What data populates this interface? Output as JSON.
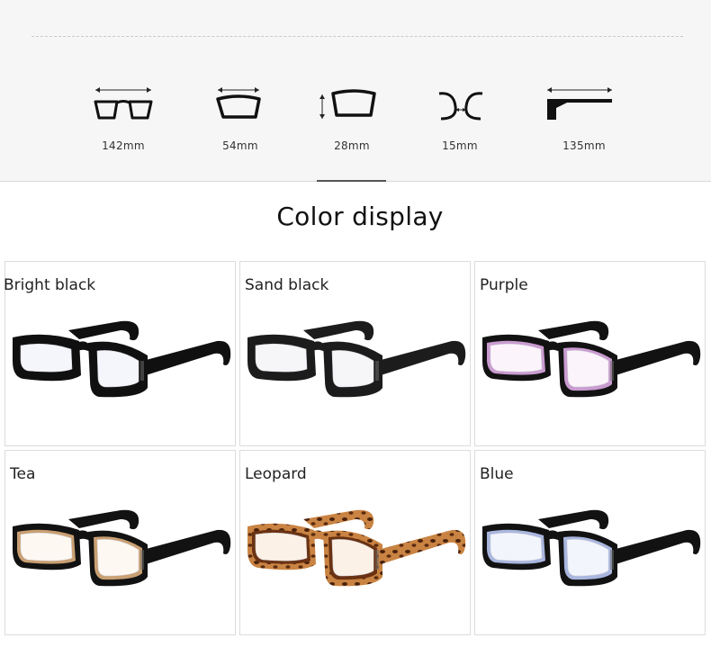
{
  "measurements": [
    {
      "icon": "frame-width-icon",
      "value": "142mm"
    },
    {
      "icon": "lens-width-icon",
      "value": "54mm"
    },
    {
      "icon": "lens-height-icon",
      "value": "28mm"
    },
    {
      "icon": "bridge-width-icon",
      "value": "15mm"
    },
    {
      "icon": "temple-length-icon",
      "value": "135mm"
    }
  ],
  "section_title": "Color display",
  "colors": [
    {
      "label": "Bright black",
      "frame": "#101010",
      "temple": "#101010",
      "lens_tint": "#f4f6fb",
      "inner": "#101010"
    },
    {
      "label": "Sand black",
      "frame": "#1c1c1c",
      "temple": "#1c1c1c",
      "lens_tint": "#f6f6f9",
      "inner": "#1c1c1c"
    },
    {
      "label": "Purple",
      "frame": "#121212",
      "temple": "#121212",
      "lens_tint": "#fbf4fb",
      "inner": "#c99bd0"
    },
    {
      "label": "Tea",
      "frame": "#121212",
      "temple": "#121212",
      "lens_tint": "#fdf8f2",
      "inner": "#c99f72"
    },
    {
      "label": "Leopard",
      "frame": "#b5652c",
      "temple": "#b5652c",
      "lens_tint": "#fbf1e6",
      "inner": "#6a3213"
    },
    {
      "label": "Blue",
      "frame": "#121212",
      "temple": "#121212",
      "lens_tint": "#f3f5fc",
      "inner": "#a9b6de"
    }
  ]
}
